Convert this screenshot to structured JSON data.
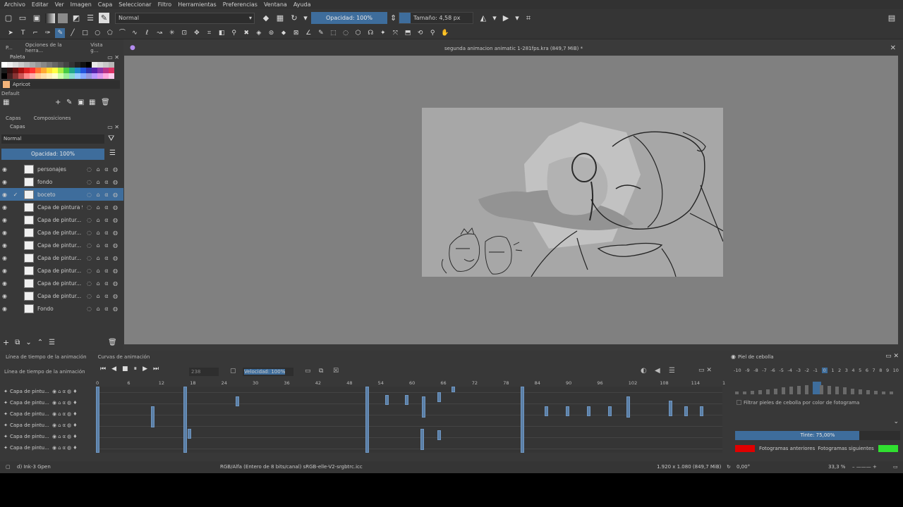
{
  "menu": [
    "Archivo",
    "Editar",
    "Ver",
    "Imagen",
    "Capa",
    "Seleccionar",
    "Filtro",
    "Herramientas",
    "Preferencias",
    "Ventana",
    "Ayuda"
  ],
  "toolbar": {
    "blend_mode": "Normal",
    "opacity_label": "Opacidad: 100%",
    "size_label": "Tamaño: 4,58 px"
  },
  "left_tabs": [
    "P...",
    "Opciones de la herra...",
    "Vista g..."
  ],
  "palette_panel": {
    "title": "Paleta",
    "color_name": "Apricot",
    "palette_name": "Default"
  },
  "layers_tabs": [
    "Capas",
    "Composiciones"
  ],
  "layers_panel": {
    "title": "Capas",
    "blend_mode": "Normal",
    "opacity_label": "Opacidad: 100%",
    "layers": [
      {
        "name": "personajes",
        "selected": false
      },
      {
        "name": "fondo",
        "selected": false
      },
      {
        "name": "boceto",
        "selected": true
      },
      {
        "name": "Capa de pintura 9",
        "selected": false
      },
      {
        "name": "Capa de pintur...",
        "selected": false
      },
      {
        "name": "Capa de pintur...",
        "selected": false
      },
      {
        "name": "Capa de pintur...",
        "selected": false
      },
      {
        "name": "Capa de pintur...",
        "selected": false
      },
      {
        "name": "Capa de pintur...",
        "selected": false
      },
      {
        "name": "Capa de pintur...",
        "selected": false
      },
      {
        "name": "Capa de pintur...",
        "selected": false
      },
      {
        "name": "Fondo",
        "selected": false
      }
    ]
  },
  "document": {
    "title": "segunda animacion animatic 1-281fps.kra (849,7 MiB) *"
  },
  "timeline": {
    "tabs": [
      "Línea de tiempo de la animación",
      "Curvas de animación"
    ],
    "header_label": "Línea de tiempo de la animación",
    "frame_value": "238",
    "speed_label": "Velocidad: 100%",
    "ruler": [
      "0",
      "6",
      "12",
      "18",
      "24",
      "30",
      "36",
      "42",
      "48",
      "54",
      "60",
      "66",
      "72",
      "78",
      "84",
      "90",
      "96",
      "102",
      "108",
      "114",
      "1"
    ],
    "layers": [
      "Capa de pintu...",
      "Capa de pintu...",
      "Capa de pintu...",
      "Capa de pintu...",
      "Capa de pintu...",
      "Capa de pintu..."
    ]
  },
  "onion_skin": {
    "title": "Piel de cebolla",
    "numbers": [
      "-10",
      "-9",
      "-8",
      "-7",
      "-6",
      "-5",
      "-4",
      "-3",
      "-2",
      "-1",
      "0",
      "1",
      "2",
      "3",
      "4",
      "5",
      "6",
      "7",
      "8",
      "9",
      "10"
    ],
    "filter_label": "Filtrar pieles de cebolla por color de fotograma",
    "tint_label": "Tinte: 75,00%",
    "tint_fraction": 0.75,
    "prev_label": "Fotogramas anteriores",
    "next_label": "Fotogramas siguientes",
    "prev_color": "#e00000",
    "next_color": "#30e030"
  },
  "status": {
    "brush": "d) Ink-3 Gpen",
    "color_space": "RGB/Alfa (Entero de 8 bits/canal)  sRGB-elle-V2-srgbtrc.icc",
    "dimensions": "1.920 x 1.080 (849,7 MiB)",
    "rotation": "0,00°",
    "zoom": "33,3 %"
  },
  "colors": {
    "accent": "#3e6d9c",
    "canvas_bg": "#808080"
  }
}
